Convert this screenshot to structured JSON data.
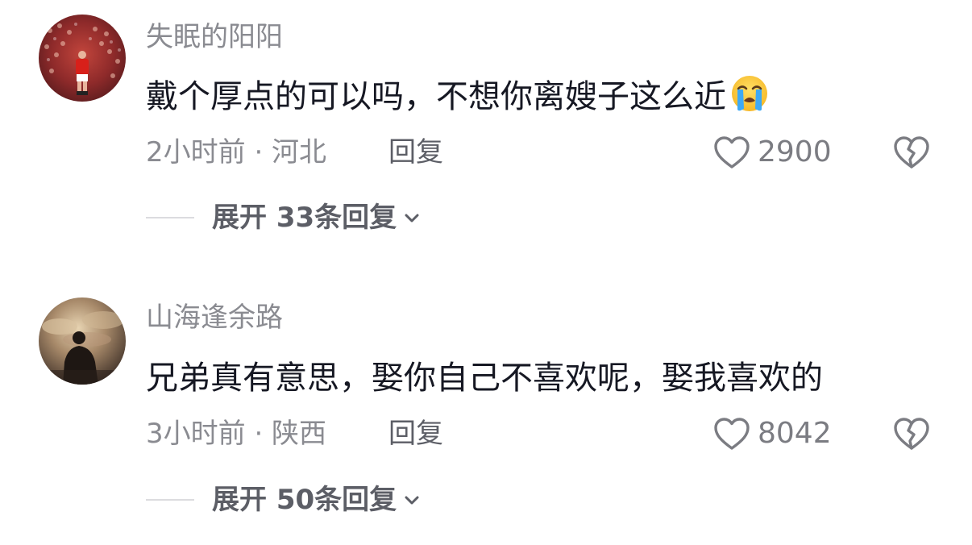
{
  "comments": [
    {
      "username": "失眠的阳阳",
      "text": "戴个厚点的可以吗，不想你离嫂子这么近",
      "emoji": "loudly-crying-face",
      "meta": "2小时前 · 河北",
      "reply_label": "回复",
      "like_count": "2900",
      "expand_label": "展开 33条回复"
    },
    {
      "username": "山海逢余路",
      "text": "兄弟真有意思，娶你自己不喜欢呢，娶我喜欢的",
      "emoji": "",
      "meta": "3小时前 · 陕西",
      "reply_label": "回复",
      "like_count": "8042",
      "expand_label": "展开 50条回复"
    }
  ],
  "colors": {
    "username": "#8a8b91",
    "text": "#161823",
    "meta": "#8a8b91",
    "action": "#5c5e66",
    "divider": "#dcdcdf"
  },
  "icons": {
    "like": "heart-outline-icon",
    "dislike": "broken-heart-icon",
    "expand": "chevron-down-icon"
  }
}
